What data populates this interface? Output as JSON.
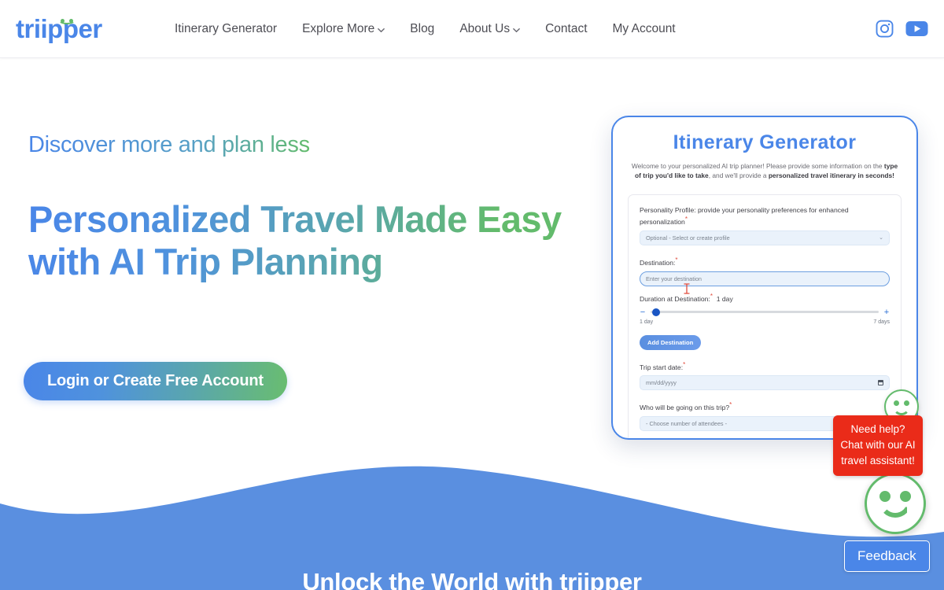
{
  "brand": {
    "name": "triipper",
    "logo_icon": "smiley-face-logo",
    "text_color": "#4a86e8",
    "accent_green": "#63bb6c"
  },
  "header": {
    "nav": [
      {
        "label": "Itinerary Generator",
        "has_dropdown": false,
        "icon": ""
      },
      {
        "label": "Explore More",
        "has_dropdown": true,
        "icon": "chevron-down-icon"
      },
      {
        "label": "Blog",
        "has_dropdown": false,
        "icon": ""
      },
      {
        "label": "About Us",
        "has_dropdown": true,
        "icon": "chevron-down-icon"
      },
      {
        "label": "Contact",
        "has_dropdown": false,
        "icon": ""
      },
      {
        "label": "My Account",
        "has_dropdown": false,
        "icon": ""
      }
    ],
    "social": [
      {
        "name": "instagram-icon",
        "label": "Instagram"
      },
      {
        "name": "youtube-icon",
        "label": "YouTube"
      }
    ]
  },
  "hero": {
    "eyebrow": "Discover more and plan less",
    "title_line1": "Personalized Travel Made Easy",
    "title_line2": "with AI Trip Planning",
    "cta_label": "Login or Create Free Account",
    "gradient_from": "#4a86e8",
    "gradient_to": "#63bb6c"
  },
  "mockup": {
    "title": "Itinerary Generator",
    "welcome_prefix": "Welcome to your personalized AI trip planner! Please provide some information on the ",
    "welcome_bold1": "type of trip you'd like to take",
    "welcome_mid": ", and we'll provide a ",
    "welcome_bold2": "personalized travel itinerary in seconds!",
    "fields": {
      "personality_label": "Personality Profile: provide your personality preferences for enhanced personalization",
      "personality_placeholder": "Optional - Select or create profile",
      "destination_label": "Destination:",
      "destination_placeholder": "Enter your destination",
      "duration_label": "Duration at Destination:",
      "duration_value": "1 day",
      "duration_min_label": "1 day",
      "duration_max_label": "7 days",
      "add_destination_label": "Add Destination",
      "start_date_label": "Trip start date:",
      "start_date_placeholder": "mm/dd/yyyy",
      "attendees_label": "Who will be going on this trip?",
      "attendees_placeholder": "- Choose number of attendees -"
    }
  },
  "chat": {
    "tooltip_text": "Need help? Chat with our AI travel assistant!",
    "tooltip_color": "#ea2b19",
    "smiley_icon": "smiley-face-icon"
  },
  "feedback": {
    "label": "Feedback",
    "color": "#4a86e8"
  },
  "footer_band": {
    "heading": "Unlock the World with triipper",
    "wave_color": "#5a8fe0"
  }
}
